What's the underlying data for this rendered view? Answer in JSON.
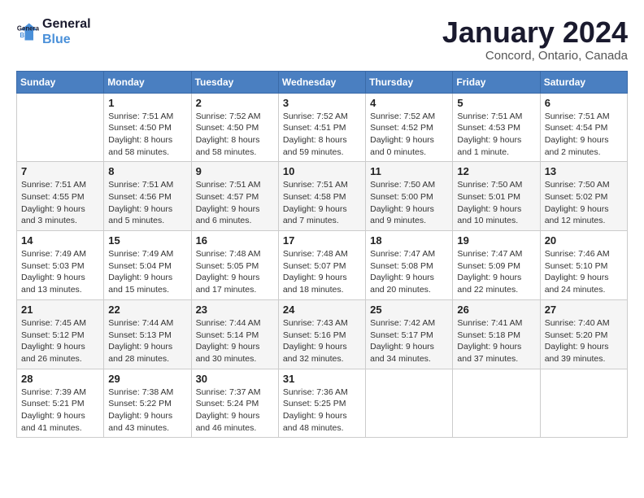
{
  "logo": {
    "line1": "General",
    "line2": "Blue"
  },
  "title": "January 2024",
  "subtitle": "Concord, Ontario, Canada",
  "days_of_week": [
    "Sunday",
    "Monday",
    "Tuesday",
    "Wednesday",
    "Thursday",
    "Friday",
    "Saturday"
  ],
  "weeks": [
    [
      {
        "day": "",
        "info": ""
      },
      {
        "day": "1",
        "info": "Sunrise: 7:51 AM\nSunset: 4:50 PM\nDaylight: 8 hours\nand 58 minutes."
      },
      {
        "day": "2",
        "info": "Sunrise: 7:52 AM\nSunset: 4:50 PM\nDaylight: 8 hours\nand 58 minutes."
      },
      {
        "day": "3",
        "info": "Sunrise: 7:52 AM\nSunset: 4:51 PM\nDaylight: 8 hours\nand 59 minutes."
      },
      {
        "day": "4",
        "info": "Sunrise: 7:52 AM\nSunset: 4:52 PM\nDaylight: 9 hours\nand 0 minutes."
      },
      {
        "day": "5",
        "info": "Sunrise: 7:51 AM\nSunset: 4:53 PM\nDaylight: 9 hours\nand 1 minute."
      },
      {
        "day": "6",
        "info": "Sunrise: 7:51 AM\nSunset: 4:54 PM\nDaylight: 9 hours\nand 2 minutes."
      }
    ],
    [
      {
        "day": "7",
        "info": "Sunrise: 7:51 AM\nSunset: 4:55 PM\nDaylight: 9 hours\nand 3 minutes."
      },
      {
        "day": "8",
        "info": "Sunrise: 7:51 AM\nSunset: 4:56 PM\nDaylight: 9 hours\nand 5 minutes."
      },
      {
        "day": "9",
        "info": "Sunrise: 7:51 AM\nSunset: 4:57 PM\nDaylight: 9 hours\nand 6 minutes."
      },
      {
        "day": "10",
        "info": "Sunrise: 7:51 AM\nSunset: 4:58 PM\nDaylight: 9 hours\nand 7 minutes."
      },
      {
        "day": "11",
        "info": "Sunrise: 7:50 AM\nSunset: 5:00 PM\nDaylight: 9 hours\nand 9 minutes."
      },
      {
        "day": "12",
        "info": "Sunrise: 7:50 AM\nSunset: 5:01 PM\nDaylight: 9 hours\nand 10 minutes."
      },
      {
        "day": "13",
        "info": "Sunrise: 7:50 AM\nSunset: 5:02 PM\nDaylight: 9 hours\nand 12 minutes."
      }
    ],
    [
      {
        "day": "14",
        "info": "Sunrise: 7:49 AM\nSunset: 5:03 PM\nDaylight: 9 hours\nand 13 minutes."
      },
      {
        "day": "15",
        "info": "Sunrise: 7:49 AM\nSunset: 5:04 PM\nDaylight: 9 hours\nand 15 minutes."
      },
      {
        "day": "16",
        "info": "Sunrise: 7:48 AM\nSunset: 5:05 PM\nDaylight: 9 hours\nand 17 minutes."
      },
      {
        "day": "17",
        "info": "Sunrise: 7:48 AM\nSunset: 5:07 PM\nDaylight: 9 hours\nand 18 minutes."
      },
      {
        "day": "18",
        "info": "Sunrise: 7:47 AM\nSunset: 5:08 PM\nDaylight: 9 hours\nand 20 minutes."
      },
      {
        "day": "19",
        "info": "Sunrise: 7:47 AM\nSunset: 5:09 PM\nDaylight: 9 hours\nand 22 minutes."
      },
      {
        "day": "20",
        "info": "Sunrise: 7:46 AM\nSunset: 5:10 PM\nDaylight: 9 hours\nand 24 minutes."
      }
    ],
    [
      {
        "day": "21",
        "info": "Sunrise: 7:45 AM\nSunset: 5:12 PM\nDaylight: 9 hours\nand 26 minutes."
      },
      {
        "day": "22",
        "info": "Sunrise: 7:44 AM\nSunset: 5:13 PM\nDaylight: 9 hours\nand 28 minutes."
      },
      {
        "day": "23",
        "info": "Sunrise: 7:44 AM\nSunset: 5:14 PM\nDaylight: 9 hours\nand 30 minutes."
      },
      {
        "day": "24",
        "info": "Sunrise: 7:43 AM\nSunset: 5:16 PM\nDaylight: 9 hours\nand 32 minutes."
      },
      {
        "day": "25",
        "info": "Sunrise: 7:42 AM\nSunset: 5:17 PM\nDaylight: 9 hours\nand 34 minutes."
      },
      {
        "day": "26",
        "info": "Sunrise: 7:41 AM\nSunset: 5:18 PM\nDaylight: 9 hours\nand 37 minutes."
      },
      {
        "day": "27",
        "info": "Sunrise: 7:40 AM\nSunset: 5:20 PM\nDaylight: 9 hours\nand 39 minutes."
      }
    ],
    [
      {
        "day": "28",
        "info": "Sunrise: 7:39 AM\nSunset: 5:21 PM\nDaylight: 9 hours\nand 41 minutes."
      },
      {
        "day": "29",
        "info": "Sunrise: 7:38 AM\nSunset: 5:22 PM\nDaylight: 9 hours\nand 43 minutes."
      },
      {
        "day": "30",
        "info": "Sunrise: 7:37 AM\nSunset: 5:24 PM\nDaylight: 9 hours\nand 46 minutes."
      },
      {
        "day": "31",
        "info": "Sunrise: 7:36 AM\nSunset: 5:25 PM\nDaylight: 9 hours\nand 48 minutes."
      },
      {
        "day": "",
        "info": ""
      },
      {
        "day": "",
        "info": ""
      },
      {
        "day": "",
        "info": ""
      }
    ]
  ]
}
